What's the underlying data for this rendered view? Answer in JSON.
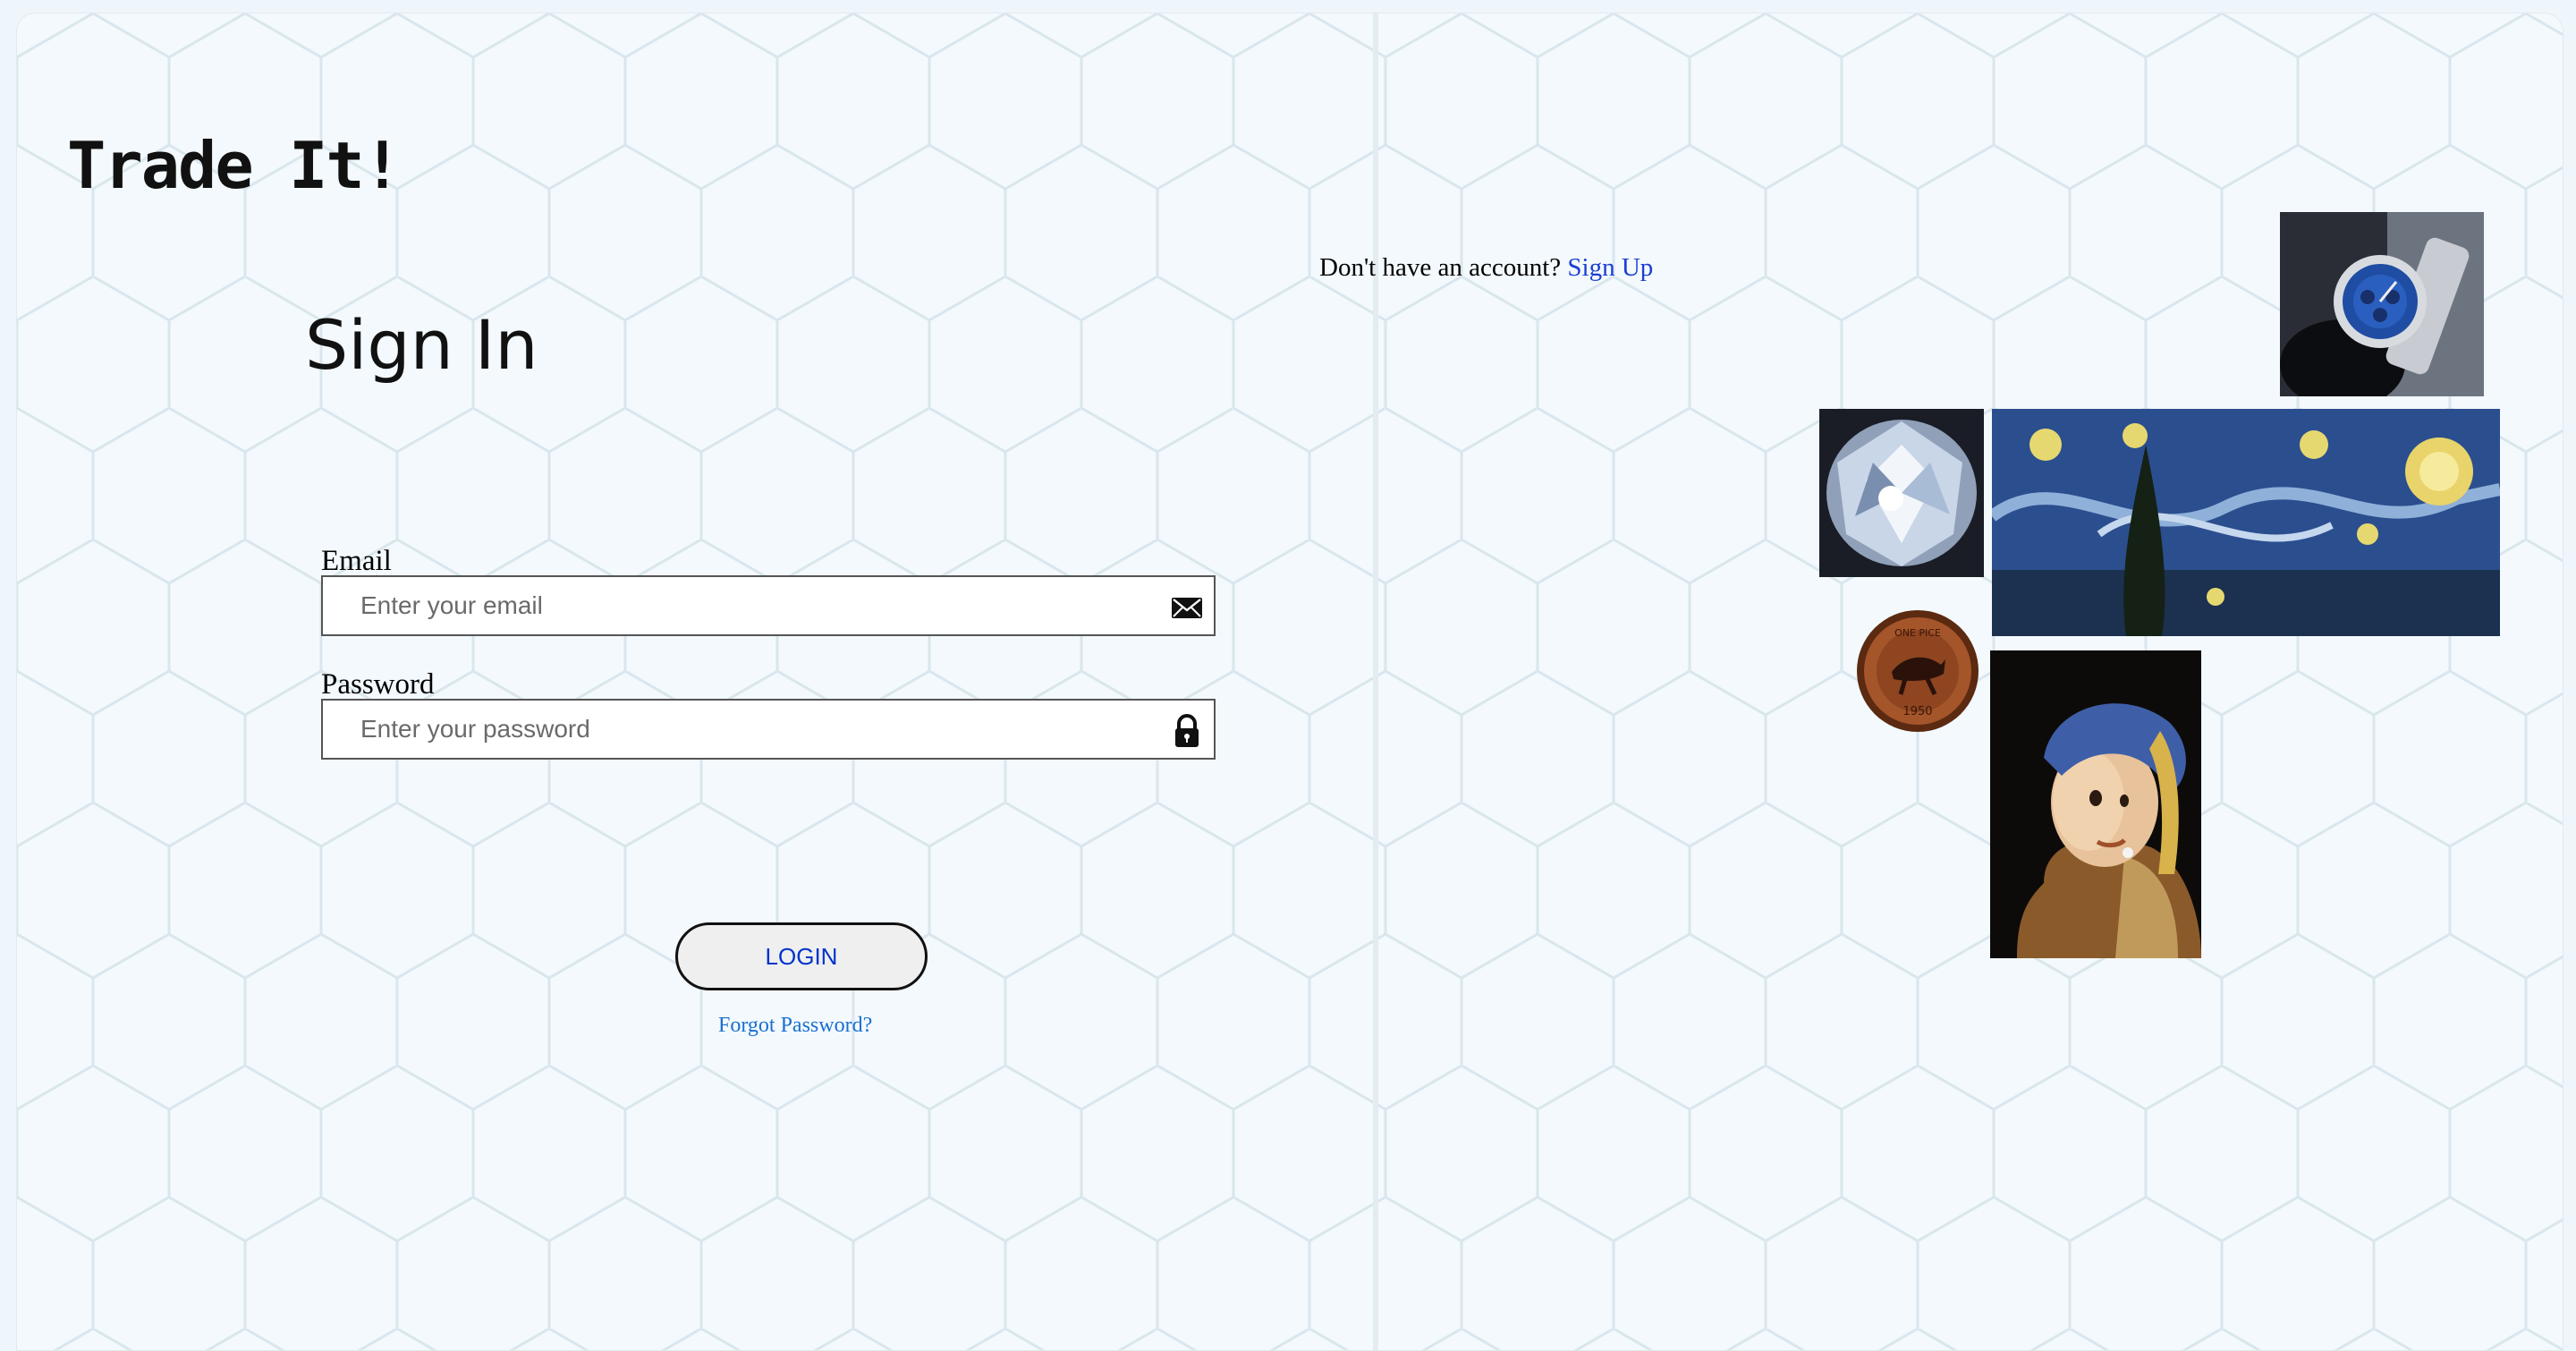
{
  "app": {
    "logo": "Trade It!"
  },
  "signin": {
    "title": "Sign In",
    "email_label": "Email",
    "email_placeholder": "Enter your email",
    "password_label": "Password",
    "password_placeholder": "Enter your password",
    "login_label": "LOGIN",
    "forgot_label": "Forgot Password?"
  },
  "signup": {
    "prompt": "Don't have an account?",
    "link_label": "Sign Up"
  },
  "gallery": {
    "coin_text_top": "ONE PICE",
    "coin_year": "1950"
  },
  "icons": {
    "email": "envelope-icon",
    "password": "lock-icon"
  },
  "colors": {
    "background": "#f3f9fd",
    "hex_pattern": "#d9e6ed",
    "link": "#1a3fd0",
    "forgot_link": "#1a6fd0",
    "login_text": "#0033cc"
  }
}
